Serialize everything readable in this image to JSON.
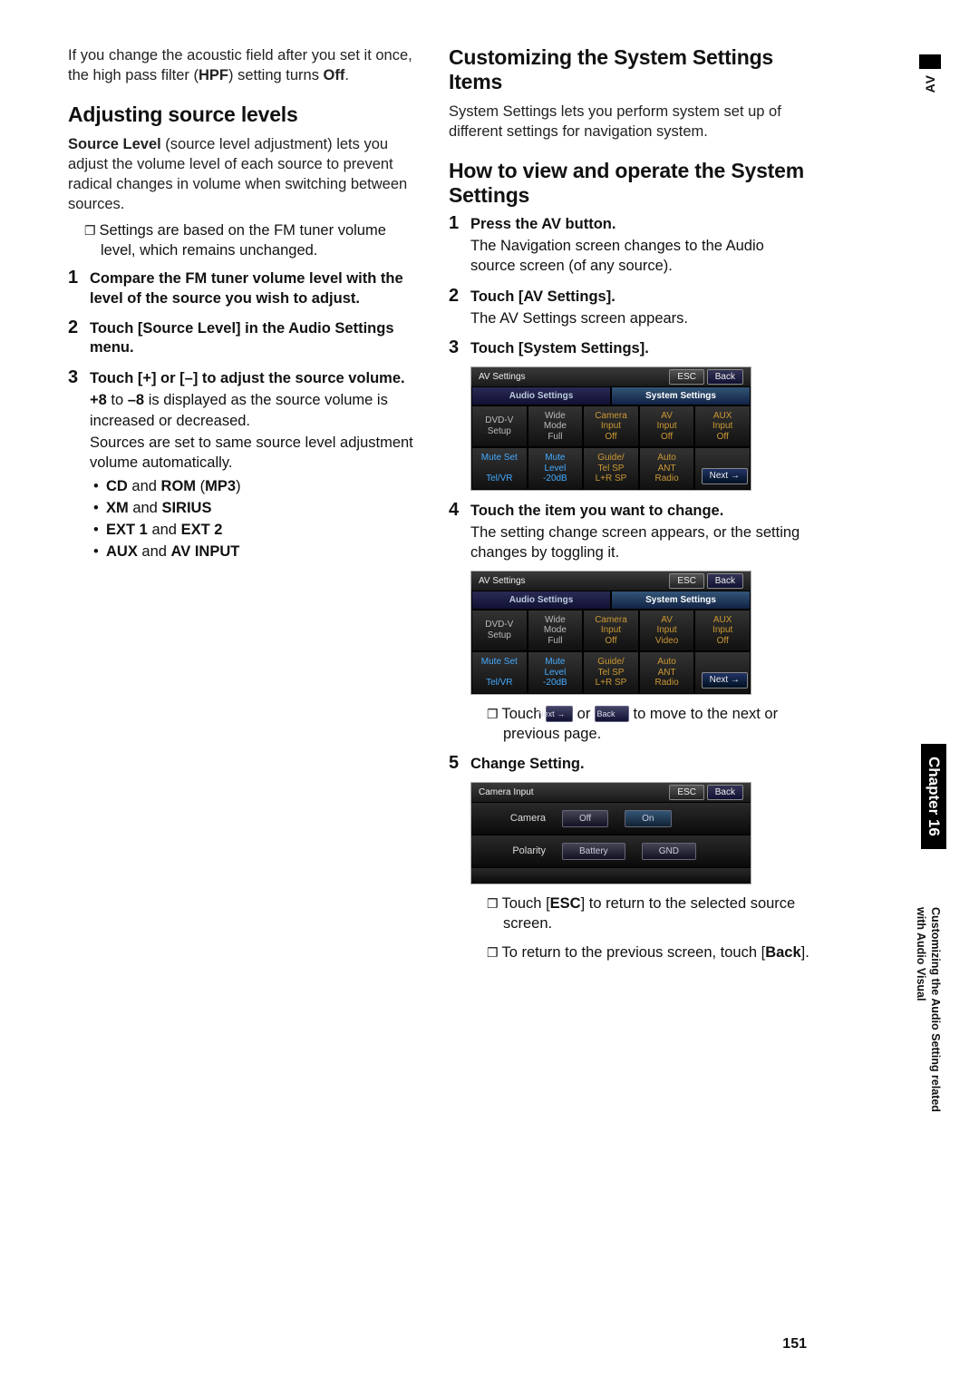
{
  "left": {
    "intro1": "If you change the acoustic field after you set it once, the high pass filter (",
    "hpf": "HPF",
    "intro2": ") setting turns ",
    "off": "Off",
    "introEnd": ".",
    "h_adjust": "Adjusting source levels",
    "srcLevelBold": "Source Level",
    "srcLevelRest": " (source level adjustment) lets you adjust the volume level of each source to prevent radical changes in volume when switching between sources.",
    "note1": "Settings are based on the FM tuner volume level, which remains unchanged.",
    "s1": "Compare the FM tuner volume level with the level of the source you wish to adjust.",
    "s2": "Touch [Source Level] in the Audio Settings menu.",
    "s3_head": "Touch [+] or [–] to adjust the source volume.",
    "s3_a_pre": "",
    "s3_plus8": "+8",
    "s3_mid1": " to ",
    "s3_minus8": "–8",
    "s3_mid2": " is displayed as the source volume is increased or decreased.",
    "s3_b": "Sources are set to same source level adjustment volume automatically.",
    "d1a": "CD",
    "d1mid": " and ",
    "d1b": "ROM",
    "d1paren": " (",
    "d1c": "MP3",
    "d1parenEnd": ")",
    "d2a": "XM",
    "d2mid": " and ",
    "d2b": "SIRIUS",
    "d3a": "EXT 1",
    "d3mid": " and ",
    "d3b": "EXT 2",
    "d4a": "AUX",
    "d4mid": " and ",
    "d4b": "AV INPUT"
  },
  "right": {
    "h_custom": "Customizing the System Settings Items",
    "p_custom": "System Settings lets you perform system set up of different settings for navigation system.",
    "h_howto": "How to view and operate the System Settings",
    "s1_head": "Press the AV button.",
    "s1_body": "The Navigation screen changes to the Audio source screen (of any source).",
    "s2_head": "Touch [AV Settings].",
    "s2_body": "The AV Settings screen appears.",
    "s3_head": "Touch [System Settings].",
    "s4_head": "Touch the item you want to change.",
    "s4_body": "The setting change screen appears, or the setting changes by toggling it.",
    "note_nav_a": "Touch ",
    "note_nav_next": "Next →",
    "note_nav_b": " or ",
    "note_nav_back": "← Back",
    "note_nav_c": " to move to the next or previous page.",
    "s5_head": "Change Setting.",
    "note5a_pre": "Touch [",
    "note5a_esc": "ESC",
    "note5a_post": "] to return to the selected source screen.",
    "note5b_pre": "To return to the previous screen, touch [",
    "note5b_back": "Back",
    "note5b_post": "]."
  },
  "shot": {
    "title": "AV Settings",
    "esc": "ESC",
    "back": "Back",
    "next": "Next →",
    "tab_audio": "Audio Settings",
    "tab_system": "System Settings",
    "r1": [
      "DVD-V\nSetup",
      "Wide\nMode\nFull",
      "Camera\nInput\nOff",
      "AV\nInput\nOff",
      "AUX\nInput\nOff"
    ],
    "r1b": [
      "DVD-V\nSetup",
      "Wide\nMode\nFull",
      "Camera\nInput\nOff",
      "AV\nInput\nVideo",
      "AUX\nInput\nOff"
    ],
    "r2": [
      "Mute Set\n\nTel/VR",
      "Mute\nLevel\n-20dB",
      "Guide/\nTel SP\nL+R SP",
      "Auto\nANT\nRadio",
      ""
    ],
    "cam_title": "Camera Input",
    "cam_r1_lbl": "Camera",
    "cam_r1_a": "Off",
    "cam_r1_b": "On",
    "cam_r2_lbl": "Polarity",
    "cam_r2_a": "Battery",
    "cam_r2_b": "GND"
  },
  "side": {
    "av": "AV",
    "chapter": "Chapter 16",
    "title": "Customizing the Audio Setting related\nwith Audio Visual"
  },
  "pageNum": "151"
}
